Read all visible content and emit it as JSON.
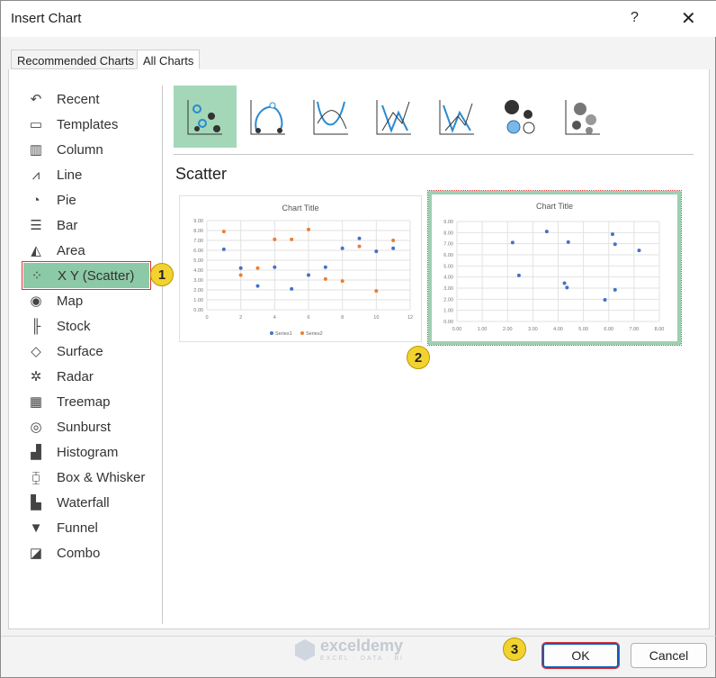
{
  "window": {
    "title": "Insert Chart",
    "help": "?",
    "close": "✕"
  },
  "tabs": [
    {
      "label": "Recommended Charts"
    },
    {
      "label": "All Charts"
    }
  ],
  "sidebar": {
    "items": [
      {
        "label": "Recent",
        "icon": "↶"
      },
      {
        "label": "Templates",
        "icon": "▭"
      },
      {
        "label": "Column",
        "icon": "▥"
      },
      {
        "label": "Line",
        "icon": "⩘"
      },
      {
        "label": "Pie",
        "icon": "◔"
      },
      {
        "label": "Bar",
        "icon": "☰"
      },
      {
        "label": "Area",
        "icon": "◭"
      },
      {
        "label": "X Y (Scatter)",
        "icon": "⁘"
      },
      {
        "label": "Map",
        "icon": "◉"
      },
      {
        "label": "Stock",
        "icon": "╟"
      },
      {
        "label": "Surface",
        "icon": "◇"
      },
      {
        "label": "Radar",
        "icon": "✲"
      },
      {
        "label": "Treemap",
        "icon": "▦"
      },
      {
        "label": "Sunburst",
        "icon": "◎"
      },
      {
        "label": "Histogram",
        "icon": "▟"
      },
      {
        "label": "Box & Whisker",
        "icon": "⧮"
      },
      {
        "label": "Waterfall",
        "icon": "▙"
      },
      {
        "label": "Funnel",
        "icon": "▼"
      },
      {
        "label": "Combo",
        "icon": "◪"
      }
    ]
  },
  "subtype_title": "Scatter",
  "badges": [
    "1",
    "2",
    "3"
  ],
  "buttons": {
    "ok": "OK",
    "cancel": "Cancel"
  },
  "watermark": {
    "name": "exceldemy",
    "tagline": "EXCEL · DATA · BI"
  },
  "colors": {
    "series1": "#4472c4",
    "series2": "#ed7d31",
    "selected": "#8cc9a6"
  },
  "chart_data": [
    {
      "type": "scatter",
      "title": "Chart Title",
      "xlim": [
        0,
        12
      ],
      "ylim": [
        0,
        9
      ],
      "xticks": [
        "0",
        "2",
        "4",
        "6",
        "8",
        "10",
        "12"
      ],
      "yticks": [
        "0.00",
        "1.00",
        "2.00",
        "3.00",
        "4.00",
        "5.00",
        "6.00",
        "7.00",
        "8.00",
        "9.00"
      ],
      "legend": "bottom",
      "grid": true,
      "series": [
        {
          "name": "Series1",
          "x": [
            1,
            2,
            3,
            4,
            5,
            6,
            7,
            8,
            9,
            10,
            11
          ],
          "y": [
            6.1,
            4.2,
            2.4,
            4.3,
            2.1,
            3.5,
            4.3,
            6.2,
            7.2,
            5.9,
            6.2
          ]
        },
        {
          "name": "Series2",
          "x": [
            1,
            2,
            3,
            4,
            5,
            6,
            7,
            8,
            9,
            10,
            11
          ],
          "y": [
            7.9,
            3.5,
            4.2,
            7.1,
            7.1,
            8.1,
            3.1,
            2.9,
            6.4,
            1.9,
            7.0
          ]
        }
      ]
    },
    {
      "type": "scatter",
      "title": "Chart Title",
      "xlim": [
        0,
        8
      ],
      "ylim": [
        0,
        9
      ],
      "xticks": [
        "0.00",
        "1.00",
        "2.00",
        "3.00",
        "4.00",
        "5.00",
        "6.00",
        "7.00",
        "8.00"
      ],
      "yticks": [
        "0.00",
        "1.00",
        "2.00",
        "3.00",
        "4.00",
        "5.00",
        "6.00",
        "7.00",
        "8.00",
        "9.00"
      ],
      "grid": true,
      "series": [
        {
          "name": "Series1",
          "x": [
            2.2,
            2.45,
            3.55,
            4.4,
            4.25,
            4.35,
            6.15,
            6.25,
            7.2,
            6.25,
            5.85
          ],
          "y": [
            7.1,
            4.15,
            8.1,
            7.15,
            3.45,
            3.05,
            7.85,
            6.95,
            6.4,
            2.85,
            1.95
          ]
        }
      ]
    }
  ]
}
